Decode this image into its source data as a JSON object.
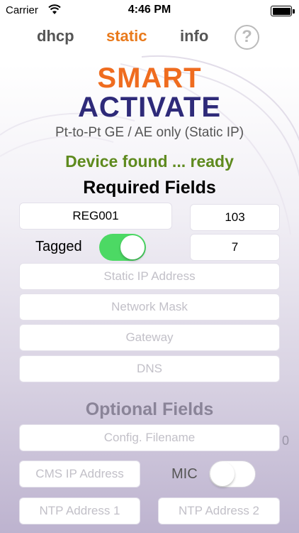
{
  "status_bar": {
    "carrier": "Carrier",
    "time": "4:46 PM"
  },
  "tabs": [
    {
      "label": "dhcp",
      "active": false
    },
    {
      "label": "static",
      "active": true
    },
    {
      "label": "info",
      "active": false
    }
  ],
  "help_label": "?",
  "logo": {
    "line1": "SMART",
    "line2": "ACTIVATE"
  },
  "subtitle": "Pt-to-Pt GE / AE only (Static IP)",
  "status_message": "Device found ... ready",
  "required": {
    "title": "Required Fields",
    "reg_value": "REG001",
    "value_103": "103",
    "tagged_label": "Tagged",
    "tagged_on": true,
    "vlan_value": "7",
    "ip_placeholder": "Static IP Address",
    "mask_placeholder": "Network Mask",
    "gateway_placeholder": "Gateway",
    "dns_placeholder": "DNS"
  },
  "optional": {
    "title": "Optional Fields",
    "config_placeholder": "Config. Filename",
    "edge_char": "0",
    "cms_placeholder": "CMS IP Address",
    "mic_label": "MIC",
    "mic_on": false,
    "ntp1_placeholder": "NTP Address 1",
    "ntp2_placeholder": "NTP Address 2"
  },
  "colors": {
    "accent_orange": "#ef6c1f",
    "brand_navy": "#2e2a79",
    "status_green": "#5e8a1e",
    "toggle_on": "#4cd964"
  }
}
